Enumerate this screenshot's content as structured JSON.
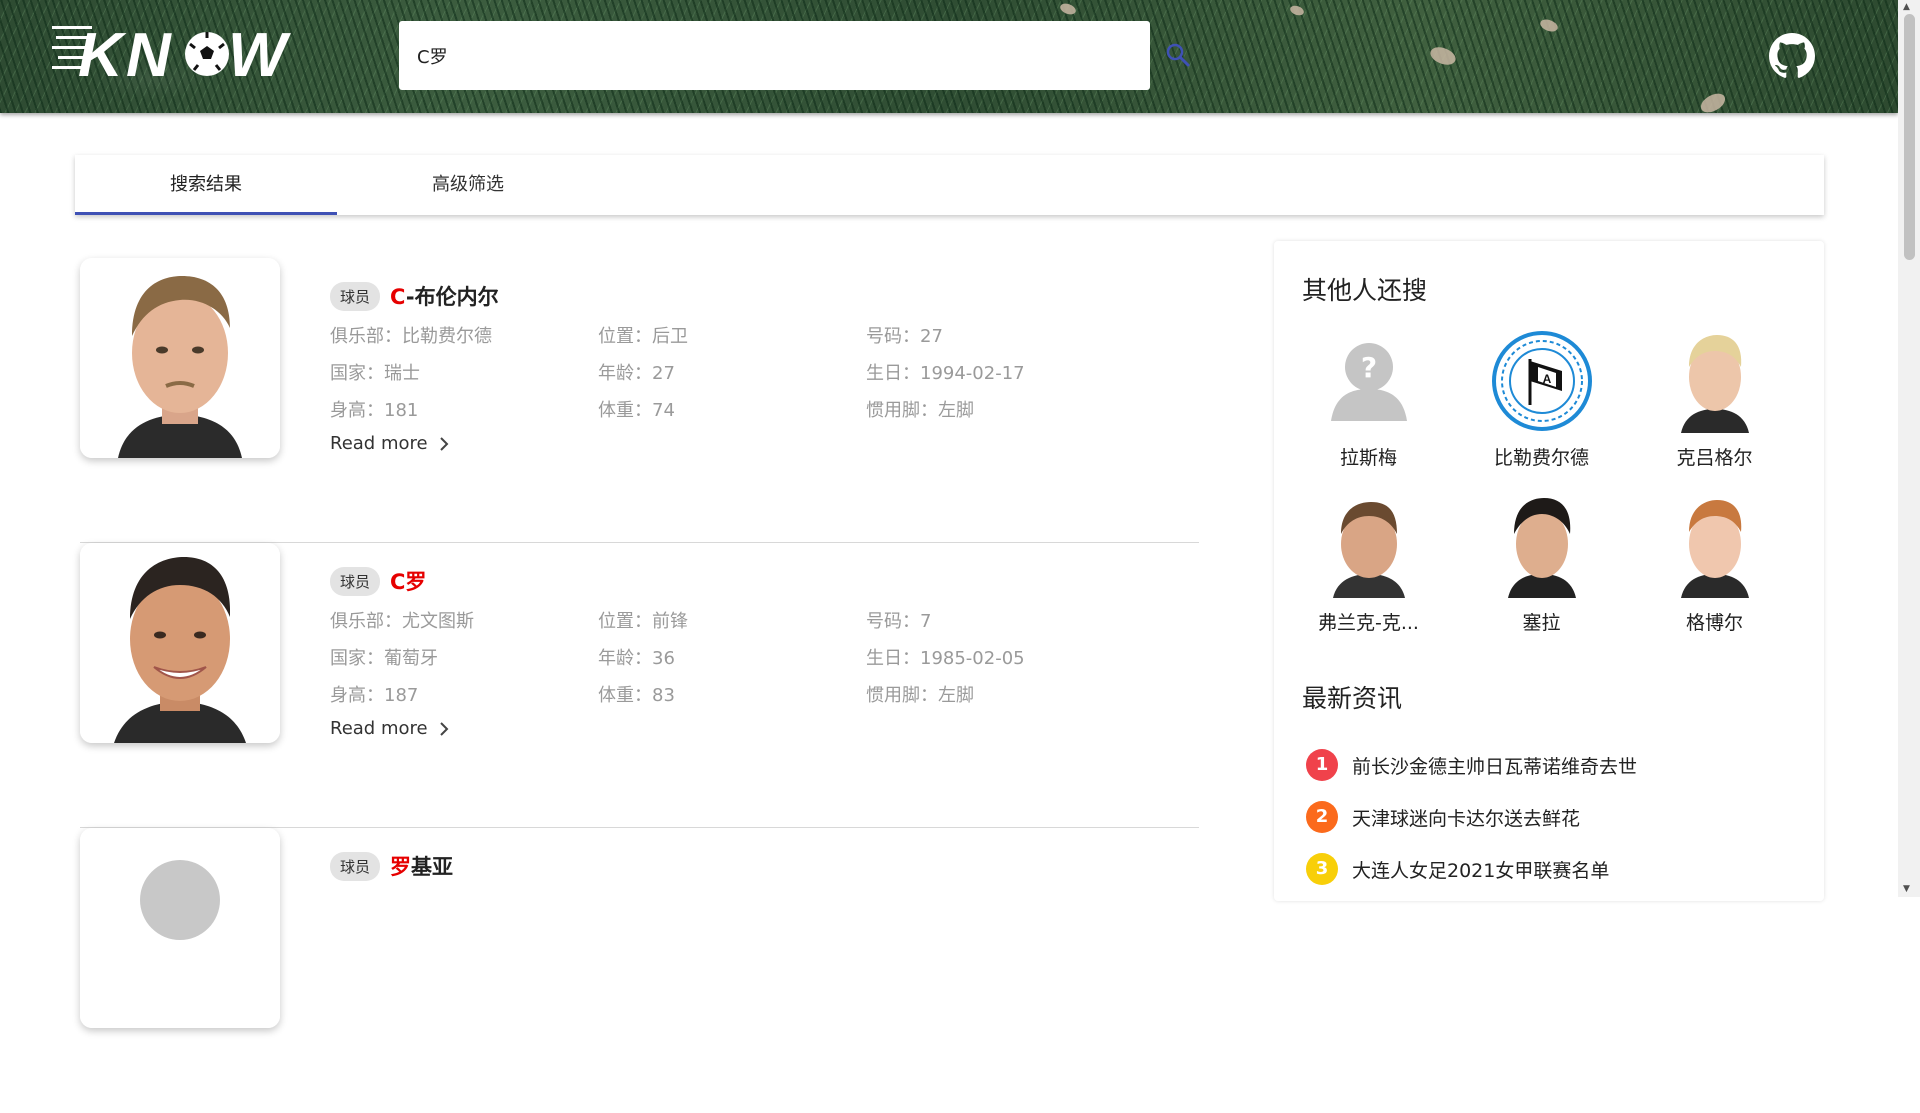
{
  "header": {
    "logo_text": "KNOW",
    "search_value": "C罗"
  },
  "tabs": [
    {
      "label": "搜索结果",
      "active": true
    },
    {
      "label": "高级筛选",
      "active": false
    }
  ],
  "results": [
    {
      "badge": "球员",
      "name_highlight": "C",
      "name_rest": "-布伦内尔",
      "fields": [
        "俱乐部：比勒费尔德",
        "位置：后卫",
        "号码：27",
        "国家：瑞士",
        "年龄：27",
        "生日：1994-02-17",
        "身高：181",
        "体重：74",
        "惯用脚：左脚"
      ],
      "read_more": "Read more"
    },
    {
      "badge": "球员",
      "name_highlight": "C罗",
      "name_rest": "",
      "fields": [
        "俱乐部：尤文图斯",
        "位置：前锋",
        "号码：7",
        "国家：葡萄牙",
        "年龄：36",
        "生日：1985-02-05",
        "身高：187",
        "体重：83",
        "惯用脚：左脚"
      ],
      "read_more": "Read more"
    },
    {
      "badge": "球员",
      "name_highlight": "罗",
      "name_rest": "基亚"
    }
  ],
  "sidebar": {
    "also_searched_title": "其他人还搜",
    "people": [
      {
        "name": "拉斯梅",
        "icon": "placeholder-person-icon"
      },
      {
        "name": "比勒费尔德",
        "icon": "club-crest-icon"
      },
      {
        "name": "克吕格尔"
      },
      {
        "name": "弗兰克-克..."
      },
      {
        "name": "塞拉"
      },
      {
        "name": "格博尔"
      }
    ],
    "news_title": "最新资讯",
    "news": [
      {
        "rank": "1",
        "text": "前长沙金德主帅日瓦蒂诺维奇去世",
        "color": "#f0424b"
      },
      {
        "rank": "2",
        "text": "天津球迷向卡达尔送去鲜花",
        "color": "#fb6a1c"
      },
      {
        "rank": "3",
        "text": "大连人女足2021女甲联赛名单",
        "color": "#f8cf09"
      }
    ]
  },
  "colors": {
    "accent": "#3f51b5",
    "highlight": "#e60000"
  }
}
